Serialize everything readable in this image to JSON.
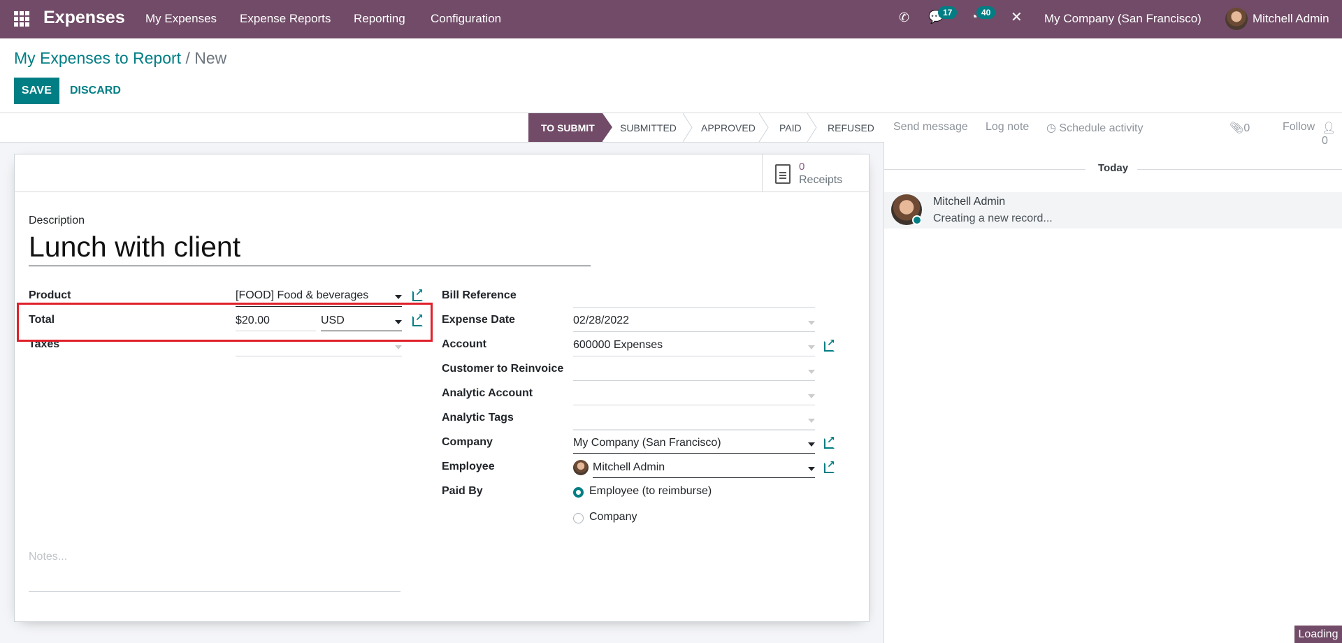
{
  "navbar": {
    "app_name": "Expenses",
    "menu": [
      "My Expenses",
      "Expense Reports",
      "Reporting",
      "Configuration"
    ],
    "messages_count": "17",
    "activities_count": "40",
    "company": "My Company (San Francisco)",
    "user": "Mitchell Admin"
  },
  "breadcrumb": {
    "parent": "My Expenses to Report",
    "separator": "/",
    "current": "New"
  },
  "actions": {
    "save": "SAVE",
    "discard": "DISCARD"
  },
  "statusbar": {
    "stages": [
      "TO SUBMIT",
      "SUBMITTED",
      "APPROVED",
      "PAID",
      "REFUSED"
    ],
    "active": "TO SUBMIT"
  },
  "receipts": {
    "count": "0",
    "label": "Receipts"
  },
  "form": {
    "description_label": "Description",
    "description": "Lunch with client",
    "left": {
      "product_label": "Product",
      "product": "[FOOD] Food & beverages",
      "total_label": "Total",
      "total": "$20.00",
      "currency": "USD",
      "taxes_label": "Taxes",
      "taxes": ""
    },
    "right": {
      "bill_ref_label": "Bill Reference",
      "bill_ref": "",
      "expense_date_label": "Expense Date",
      "expense_date": "02/28/2022",
      "account_label": "Account",
      "account": "600000 Expenses",
      "customer_label": "Customer to Reinvoice",
      "customer": "",
      "analytic_account_label": "Analytic Account",
      "analytic_account": "",
      "analytic_tags_label": "Analytic Tags",
      "analytic_tags": "",
      "company_label": "Company",
      "company": "My Company (San Francisco)",
      "employee_label": "Employee",
      "employee": "Mitchell Admin",
      "paid_by_label": "Paid By",
      "paid_by_options": [
        "Employee (to reimburse)",
        "Company"
      ],
      "paid_by_selected": "Employee (to reimburse)"
    },
    "notes_placeholder": "Notes..."
  },
  "chatter": {
    "send_message": "Send message",
    "log_note": "Log note",
    "schedule_activity": "Schedule activity",
    "attachments": "0",
    "follow": "Follow",
    "followers": "0",
    "date_separator": "Today",
    "messages": [
      {
        "author": "Mitchell Admin",
        "body": "Creating a new record..."
      }
    ]
  },
  "loading": "Loading",
  "colors": {
    "brand": "#714B67",
    "accent": "#017e84",
    "highlight": "#e0202a"
  }
}
